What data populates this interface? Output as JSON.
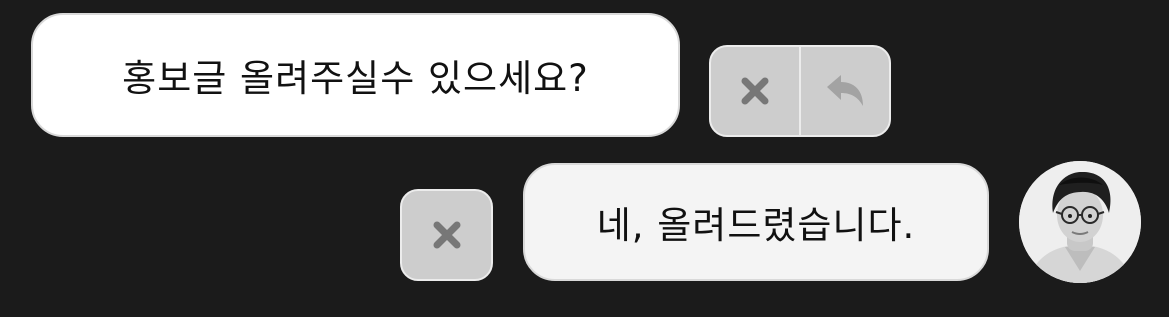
{
  "chat": {
    "incoming": {
      "text": "홍보글 올려주실수 있으세요?",
      "actions": [
        {
          "icon": "close-icon"
        },
        {
          "icon": "reply-icon"
        }
      ]
    },
    "outgoing": {
      "text": "네, 올려드렸습니다.",
      "actions": [
        {
          "icon": "close-icon"
        }
      ]
    },
    "avatar": {
      "icon": "avatar-photo"
    }
  },
  "colors": {
    "background": "#1b1b1b",
    "incoming_bubble": "#ffffff",
    "outgoing_bubble": "#f4f4f4",
    "action_button": "#cdcdcd",
    "icon": "#777777",
    "text": "#111111"
  }
}
